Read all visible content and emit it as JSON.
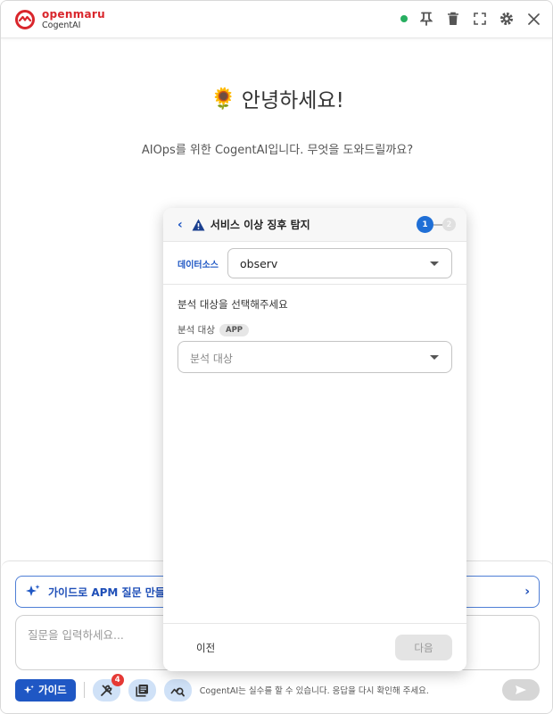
{
  "header": {
    "brand": "openmaru",
    "product": "CogentAI",
    "icons": [
      "status-dot",
      "pin-icon",
      "trash-icon",
      "fullscreen-icon",
      "gear-icon",
      "close-icon"
    ],
    "status_color": "#27ae60"
  },
  "welcome": {
    "emoji": "🌻",
    "title": "안녕하세요!",
    "subtitle": "AIOps를 위한 CogentAI입니다. 무엇을 도와드릴까요?"
  },
  "popup": {
    "title": "서비스 이상 징후 탐지",
    "steps": [
      "1",
      "2"
    ],
    "datasource_label": "데이터소스",
    "datasource_value": "observ",
    "section_heading": "분석 대상을 선택해주세요",
    "target_label": "분석 대상",
    "target_tag": "APP",
    "target_placeholder": "분석 대상",
    "prev_label": "이전",
    "next_label": "다음"
  },
  "bottom": {
    "guide_banner": "가이드로 APM 질문 만들",
    "input_placeholder": "질문을 입력하세요...",
    "guide_button": "가이드",
    "tools_badge": "4",
    "disclaimer": "CogentAI는 실수를 할 수 있습니다. 응답을 다시 확인해 주세요."
  },
  "colors": {
    "brand_red": "#d9262c",
    "primary_blue": "#1f57c4",
    "tool_bg": "#cfe1f7"
  }
}
